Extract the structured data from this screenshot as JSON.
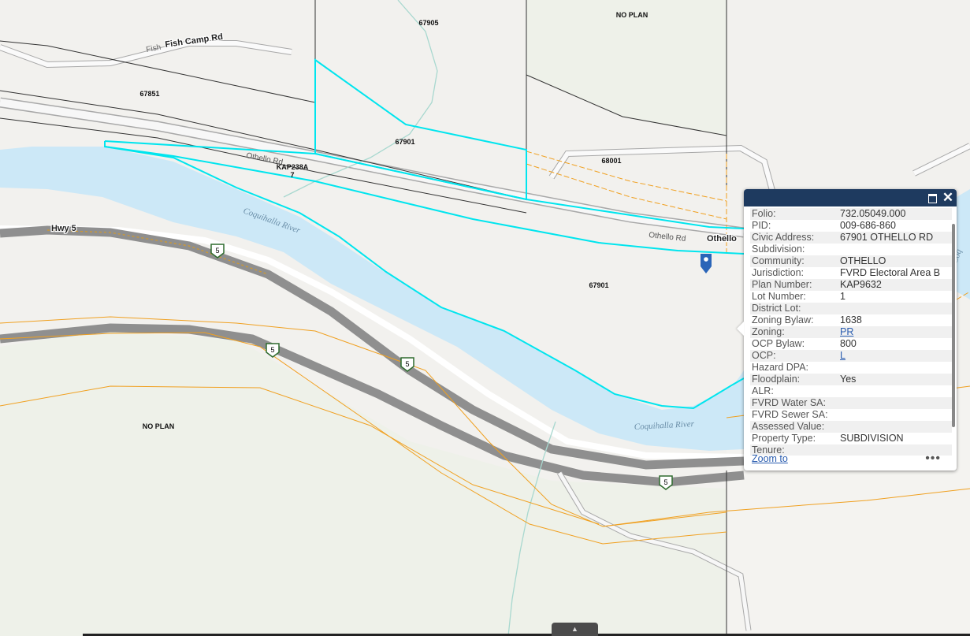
{
  "map": {
    "parcel_labels": [
      "67905",
      "NO PLAN",
      "67851",
      "67901",
      "68001",
      "KAP238A",
      "7",
      "67901",
      "NO PLAN"
    ],
    "road_labels": {
      "fish_camp_small": "Fish",
      "fish_camp": "Fish Camp Rd",
      "othello_1": "Othello Rd",
      "othello_2": "Othello Rd",
      "othello_bold": "Othello",
      "hwy": "Hwy 5"
    },
    "river_labels": [
      "Coquihalla River",
      "Coquihalla River",
      "Coq"
    ],
    "shield_numbers": [
      "5",
      "5",
      "5",
      "5"
    ],
    "colors": {
      "river": "#cce8f7",
      "selection": "#00e5ee",
      "parcel_line": "#333333",
      "boundary": "#f0a020",
      "highway": "#8f8f8f",
      "forest": "#eef1e9"
    }
  },
  "popup": {
    "attributes": [
      {
        "key": "Folio:",
        "value": "732.05049.000"
      },
      {
        "key": "PID:",
        "value": "009-686-860"
      },
      {
        "key": "Civic Address:",
        "value": "67901 OTHELLO RD"
      },
      {
        "key": "Subdivision:",
        "value": ""
      },
      {
        "key": "Community:",
        "value": "OTHELLO"
      },
      {
        "key": "Jurisdiction:",
        "value": "FVRD Electoral Area B"
      },
      {
        "key": "Plan Number:",
        "value": "KAP9632"
      },
      {
        "key": "Lot Number:",
        "value": "1"
      },
      {
        "key": "District Lot:",
        "value": ""
      },
      {
        "key": "Zoning Bylaw:",
        "value": "1638"
      },
      {
        "key": "Zoning:",
        "value": "PR"
      },
      {
        "key": "OCP Bylaw:",
        "value": "800"
      },
      {
        "key": "OCP:",
        "value": "L"
      },
      {
        "key": "Hazard DPA:",
        "value": ""
      },
      {
        "key": "Floodplain:",
        "value": "Yes"
      },
      {
        "key": "ALR:",
        "value": ""
      },
      {
        "key": "FVRD Water SA:",
        "value": ""
      },
      {
        "key": "FVRD Sewer SA:",
        "value": ""
      },
      {
        "key": "Assessed Value:",
        "value": ""
      },
      {
        "key": "Property Type:",
        "value": "SUBDIVISION"
      },
      {
        "key": "Tenure:",
        "value": ""
      }
    ],
    "zoom_to": "Zoom to",
    "more": "•••",
    "close": "✕"
  }
}
